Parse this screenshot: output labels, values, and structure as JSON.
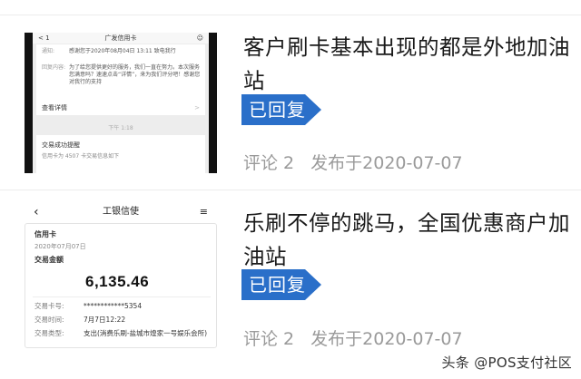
{
  "posts": [
    {
      "title": "客户刷卡基本出现的都是外地加油站",
      "badge": "已回复",
      "comments": "评论 2",
      "published": "发布于2020-07-07",
      "thumb": {
        "nav_back": "< 1",
        "nav_title": "广发信用卡",
        "card_rows": [
          {
            "key": "通知:",
            "value": "感谢您于2020年08月04日 13:11 致电我行"
          },
          {
            "key": "回复内容:",
            "value": "为了给您提供更好的服务，我们一直在努力。本次服务您满意吗？速速点击“详情”，来为我们评分吧！感谢您对我行的支持"
          }
        ],
        "more_label": "查看详情",
        "time_label": "下午 1:18",
        "card2_title": "交易成功提醒",
        "card2_sub": "信用卡为 4507 卡交易信息如下"
      }
    },
    {
      "title": "乐刷不停的跳马，全国优惠商户加油站",
      "badge": "已回复",
      "comments": "评论 2",
      "published": "发布于2020-07-07",
      "thumb": {
        "nav_title": "工银信使",
        "card_type": "信用卡",
        "card_date": "2020年07月07日",
        "amount_label": "交易金额",
        "amount": "6,135.46",
        "rows": [
          {
            "key": "交易卡号:",
            "value": "************5354"
          },
          {
            "key": "交易时间:",
            "value": "7月7日12:22"
          },
          {
            "key": "交易类型:",
            "value": "支出(消费乐刷-盐城市煌家一号娱乐会所)"
          }
        ]
      }
    }
  ],
  "watermark": "头条 @POS支付社区",
  "colors": {
    "badge": "#2a6fc9",
    "meta": "#9a9a9a"
  }
}
